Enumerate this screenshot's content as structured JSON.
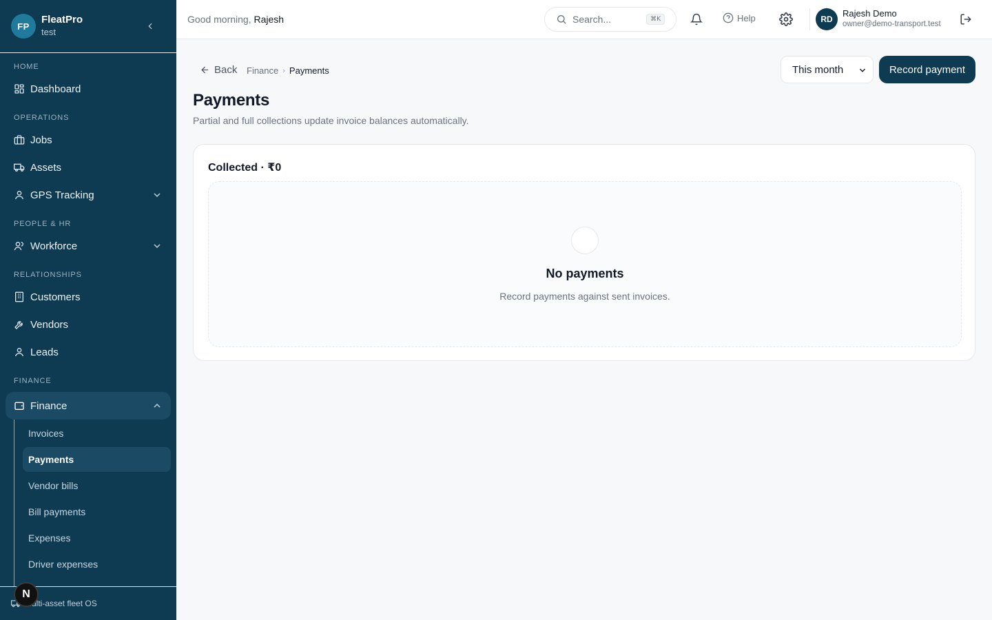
{
  "brand": {
    "initials": "FP",
    "name": "FleatPro",
    "subtitle": "test"
  },
  "sidebar": {
    "sections": [
      {
        "label": "HOME"
      },
      {
        "label": "OPERATIONS"
      },
      {
        "label": "PEOPLE & HR"
      },
      {
        "label": "RELATIONSHIPS"
      },
      {
        "label": "FINANCE"
      }
    ],
    "items": {
      "dashboard": "Dashboard",
      "jobs": "Jobs",
      "assets": "Assets",
      "gps": "GPS Tracking",
      "workforce": "Workforce",
      "customers": "Customers",
      "vendors": "Vendors",
      "leads": "Leads",
      "finance": "Finance"
    },
    "finance_sub": [
      "Invoices",
      "Payments",
      "Vendor bills",
      "Bill payments",
      "Expenses",
      "Driver expenses"
    ],
    "footer": "Multi-asset fleet OS",
    "badge": "N"
  },
  "header": {
    "greeting": "Good morning,",
    "greeting_name": "Rajesh",
    "search_placeholder": "Search...",
    "search_shortcut": "⌘K",
    "help_label": "Help",
    "user_initials": "RD",
    "user_name": "Rajesh Demo",
    "user_email": "owner@demo-transport.test"
  },
  "page": {
    "back_label": "Back",
    "breadcrumb": [
      "Finance",
      "Payments"
    ],
    "period": "This month",
    "record_button": "Record payment",
    "title": "Payments",
    "subtitle": "Partial and full collections update invoice balances automatically.",
    "card_title": "Collected · ₹0",
    "empty_title": "No payments",
    "empty_sub": "Record payments against sent invoices."
  },
  "colors": {
    "sidebar": "#0e3a52",
    "accent": "#0e3a52",
    "brand_avatar": "#1f7a9c"
  }
}
